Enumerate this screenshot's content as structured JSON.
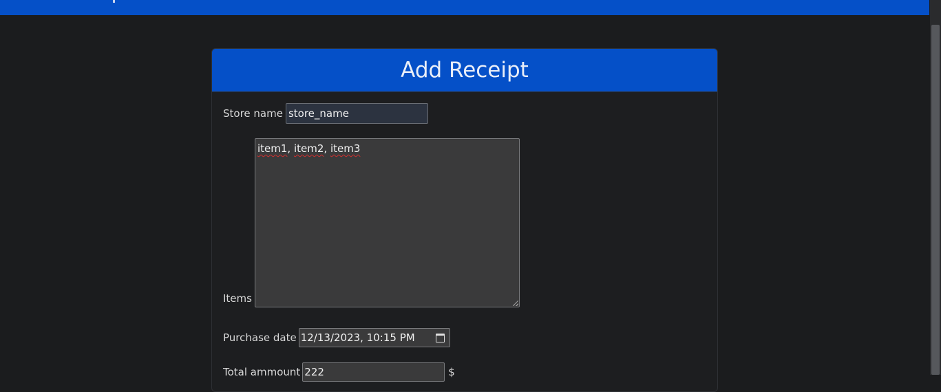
{
  "form": {
    "title": "Add Receipt",
    "store_name": {
      "label": "Store name",
      "value": "store_name"
    },
    "items": {
      "label": "Items",
      "value_parts": [
        "item1",
        ", ",
        "item2",
        ", ",
        "item3"
      ]
    },
    "purchase_date": {
      "label": "Purchase date",
      "value": "12/13/2023, 10:15 PM",
      "icon": "calendar-icon"
    },
    "total_amount": {
      "label": "Total ammount",
      "value": "222",
      "currency": "$"
    }
  },
  "colors": {
    "header_blue": "#0550c8",
    "page_bg": "#1b1c1e",
    "input_bg": "#3a3a3b"
  }
}
